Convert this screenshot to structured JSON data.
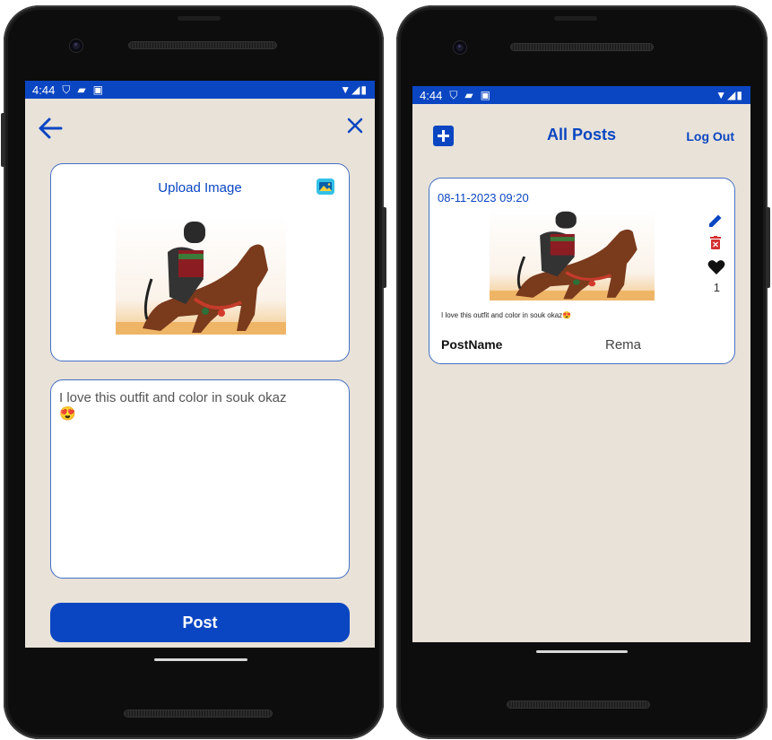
{
  "left_screen": {
    "status": {
      "time": "4:44"
    },
    "upload": {
      "title": "Upload Image"
    },
    "caption": {
      "text": "I love this outfit  and color in souk okaz",
      "emoji": "😍"
    },
    "post_button": "Post"
  },
  "right_screen": {
    "status": {
      "time": "4:44"
    },
    "header": {
      "title": "All Posts",
      "logout": "Log Out"
    },
    "post": {
      "date": "08-11-2023 09:20",
      "text": "I love this outfit  and color in souk okaz😍",
      "likes": "1",
      "name_label": "PostName",
      "name_value": "Rema"
    }
  },
  "colors": {
    "primary": "#0b46c2",
    "background": "#e8e2d9",
    "card_border": "#4570c4"
  },
  "icons": [
    "arrow-left-icon",
    "close-icon",
    "gallery-icon",
    "add-icon",
    "edit-icon",
    "delete-icon",
    "heart-icon"
  ]
}
